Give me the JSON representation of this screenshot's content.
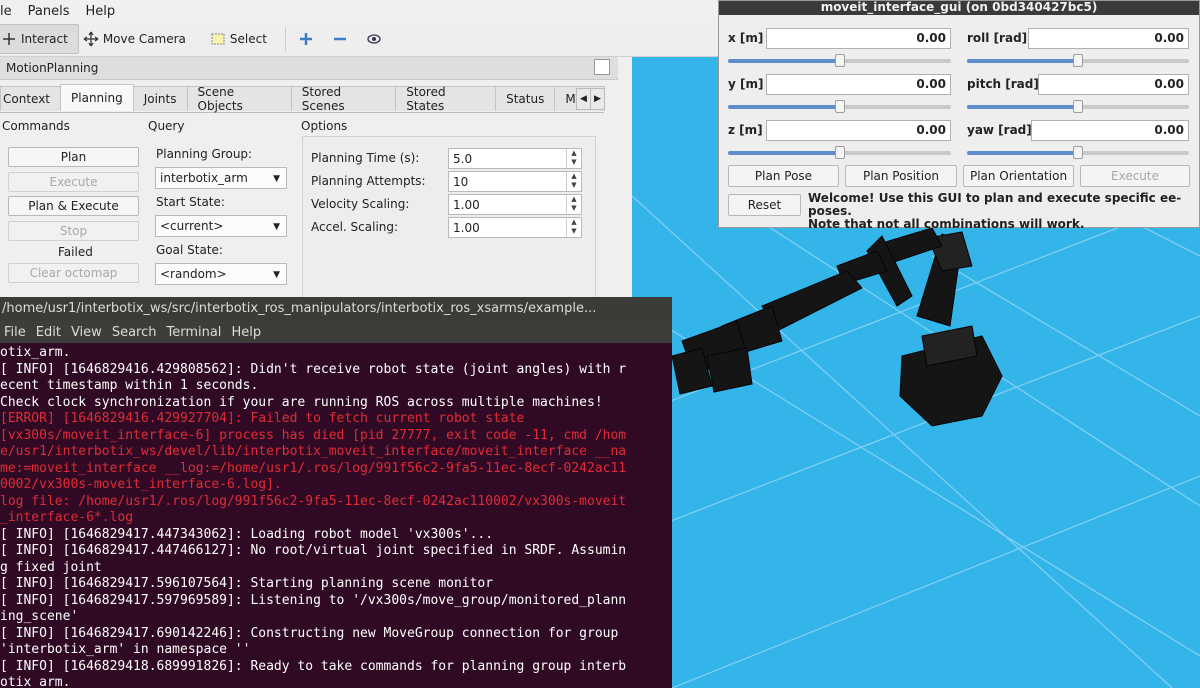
{
  "rviz": {
    "menu": [
      "le",
      "Panels",
      "Help"
    ],
    "tools": {
      "interact": "Interact",
      "move_camera": "Move Camera",
      "select": "Select"
    },
    "panel_title": "MotionPlanning",
    "tabs": [
      "Context",
      "Planning",
      "Joints",
      "Scene Objects",
      "Stored Scenes",
      "Stored States",
      "Status",
      "Mani"
    ],
    "commands": {
      "label": "Commands",
      "plan": "Plan",
      "execute": "Execute",
      "plan_execute": "Plan & Execute",
      "stop": "Stop",
      "status": "Failed",
      "clear_octomap": "Clear octomap"
    },
    "query": {
      "label": "Query",
      "planning_group_label": "Planning Group:",
      "planning_group": "interbotix_arm",
      "start_state_label": "Start State:",
      "start_state": "<current>",
      "goal_state_label": "Goal State:",
      "goal_state": "<random>"
    },
    "options": {
      "label": "Options",
      "planning_time_label": "Planning Time (s):",
      "planning_time": "5.0",
      "planning_attempts_label": "Planning Attempts:",
      "planning_attempts": "10",
      "velocity_label": "Velocity Scaling:",
      "velocity": "1.00",
      "accel_label": "Accel. Scaling:",
      "accel": "1.00"
    }
  },
  "gui": {
    "title": "moveit_interface_gui (on 0bd340427bc5)",
    "x_label": "x [m]",
    "x": "0.00",
    "x_slider": 0.5,
    "y_label": "y [m]",
    "y": "0.00",
    "y_slider": 0.5,
    "z_label": "z [m]",
    "z": "0.00",
    "z_slider": 0.5,
    "roll_label": "roll [rad]",
    "roll": "0.00",
    "roll_slider": 0.5,
    "pitch_label": "pitch [rad]",
    "pitch": "0.00",
    "pitch_slider": 0.5,
    "yaw_label": "yaw [rad]",
    "yaw": "0.00",
    "yaw_slider": 0.5,
    "plan_pose": "Plan Pose",
    "plan_position": "Plan Position",
    "plan_orientation": "Plan Orientation",
    "execute": "Execute",
    "reset": "Reset",
    "welcome_1": "Welcome! Use this GUI to plan and execute specific ee-poses.",
    "welcome_2": "Note that not all combinations will work."
  },
  "terminal": {
    "title": "/home/usr1/interbotix_ws/src/interbotix_ros_manipulators/interbotix_ros_xsarms/example...",
    "menu": [
      "File",
      "Edit",
      "View",
      "Search",
      "Terminal",
      "Help"
    ],
    "lines": [
      {
        "t": "otix_arm.",
        "err": false
      },
      {
        "t": "[ INFO] [1646829416.429808562]: Didn't receive robot state (joint angles) with r",
        "err": false
      },
      {
        "t": "ecent timestamp within 1 seconds.",
        "err": false
      },
      {
        "t": "Check clock synchronization if your are running ROS across multiple machines!",
        "err": false
      },
      {
        "t": "[ERROR] [1646829416.429927704]: Failed to fetch current robot state",
        "err": true
      },
      {
        "t": "[vx300s/moveit_interface-6] process has died [pid 27777, exit code -11, cmd /hom",
        "err": true
      },
      {
        "t": "e/usr1/interbotix_ws/devel/lib/interbotix_moveit_interface/moveit_interface __na",
        "err": true
      },
      {
        "t": "me:=moveit_interface __log:=/home/usr1/.ros/log/991f56c2-9fa5-11ec-8ecf-0242ac11",
        "err": true
      },
      {
        "t": "0002/vx300s-moveit_interface-6.log].",
        "err": true
      },
      {
        "t": "log file: /home/usr1/.ros/log/991f56c2-9fa5-11ec-8ecf-0242ac110002/vx300s-moveit",
        "err": true
      },
      {
        "t": "_interface-6*.log",
        "err": true
      },
      {
        "t": "[ INFO] [1646829417.447343062]: Loading robot model 'vx300s'...",
        "err": false
      },
      {
        "t": "[ INFO] [1646829417.447466127]: No root/virtual joint specified in SRDF. Assumin",
        "err": false
      },
      {
        "t": "g fixed joint",
        "err": false
      },
      {
        "t": "[ INFO] [1646829417.596107564]: Starting planning scene monitor",
        "err": false
      },
      {
        "t": "[ INFO] [1646829417.597969589]: Listening to '/vx300s/move_group/monitored_plann",
        "err": false
      },
      {
        "t": "ing_scene'",
        "err": false
      },
      {
        "t": "[ INFO] [1646829417.690142246]: Constructing new MoveGroup connection for group",
        "err": false
      },
      {
        "t": "'interbotix_arm' in namespace ''",
        "err": false
      },
      {
        "t": "[ INFO] [1646829418.689991826]: Ready to take commands for planning group interb",
        "err": false
      },
      {
        "t": "otix_arm.",
        "err": false
      }
    ]
  }
}
